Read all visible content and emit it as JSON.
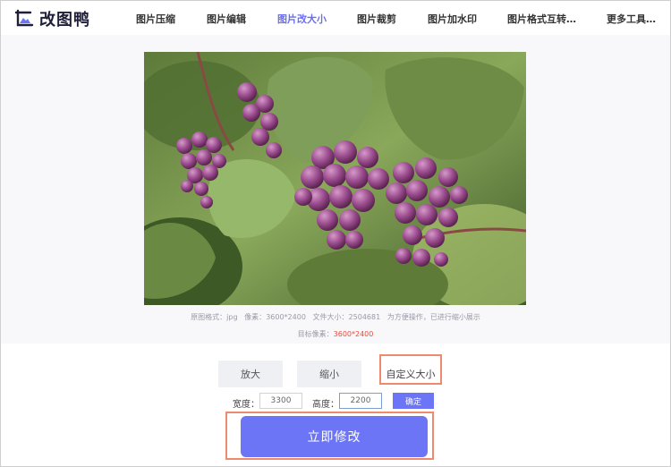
{
  "app": {
    "logo_text": "改图鸭"
  },
  "nav": {
    "items": [
      {
        "label": "图片压缩"
      },
      {
        "label": "图片编辑"
      },
      {
        "label": "图片改大小",
        "active": true
      },
      {
        "label": "图片裁剪"
      },
      {
        "label": "图片加水印"
      },
      {
        "label": "图片格式互转…"
      },
      {
        "label": "更多工具…"
      }
    ]
  },
  "preview": {
    "image": "grape-cluster-photo",
    "info": {
      "format_label": "原图格式：",
      "format_value": "jpg",
      "pixels_label": "像素：",
      "pixels_value": "3600*2400",
      "size_label": "文件大小：",
      "size_value": "2504681",
      "note": "为方便操作，已进行缩小展示"
    },
    "target_label": "目标像素：",
    "target_value": "3600*2400"
  },
  "modes": {
    "enlarge": "放大",
    "shrink": "缩小",
    "custom": "自定义大小"
  },
  "inputs": {
    "width_label": "宽度：",
    "width_value": "3300",
    "height_label": "高度：",
    "height_value": "2200",
    "confirm_label": "确定"
  },
  "actions": {
    "modify_label": "立即修改"
  },
  "colors": {
    "accent": "#6b75f5",
    "highlight_border": "#f08a6c",
    "target_value": "#e84a3b"
  }
}
